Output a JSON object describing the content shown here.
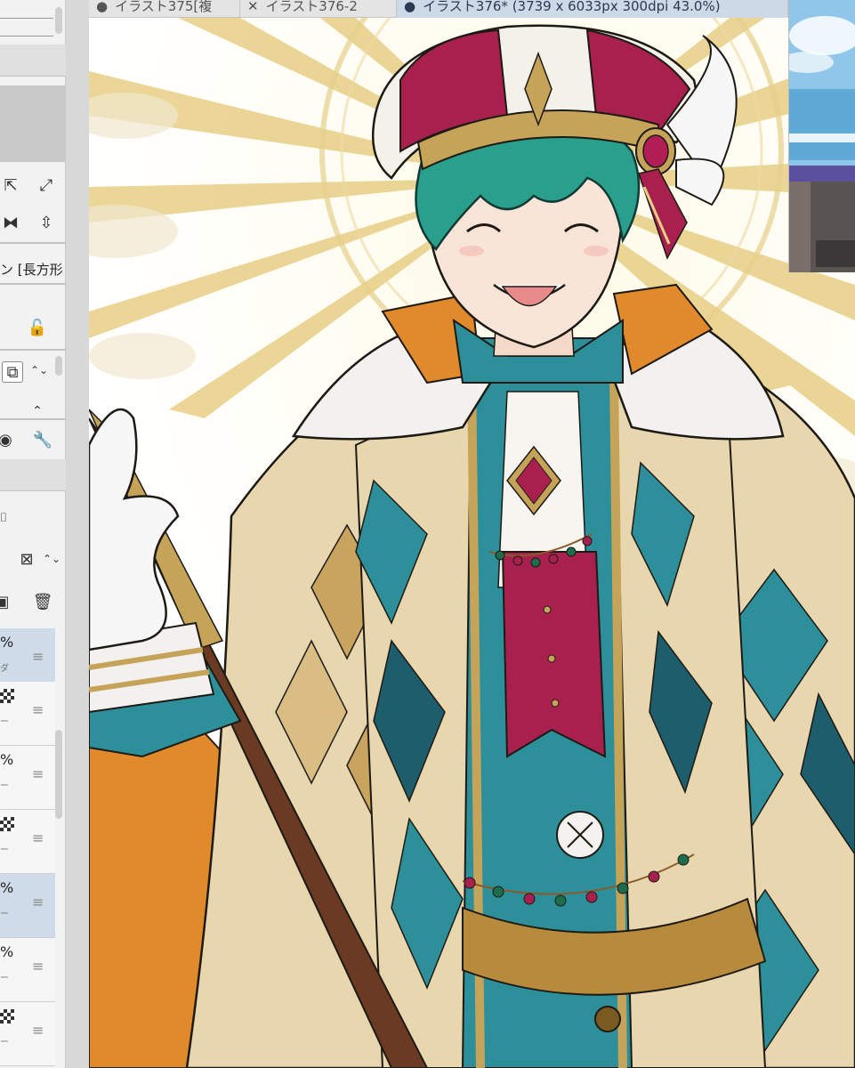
{
  "tabs": [
    {
      "label": "イラスト375[複",
      "marker": "●"
    },
    {
      "label": "イラスト376-2",
      "marker": "✕"
    },
    {
      "label": "イラスト376* (3739 x 6033px 300dpi 43.0%)",
      "marker": "●"
    }
  ],
  "tool_property": {
    "shape_label": "ン [長方形"
  },
  "layers": [
    {
      "opacity": "%",
      "sub": "ダ"
    },
    {
      "opacity": "",
      "sub": "ー"
    },
    {
      "opacity": "%",
      "sub": "ー"
    },
    {
      "opacity": "",
      "sub": "ー"
    },
    {
      "opacity": "%",
      "sub": "ー"
    },
    {
      "opacity": "%",
      "sub": "ー"
    },
    {
      "opacity": "",
      "sub": "ー"
    }
  ],
  "colors": {
    "teal": "#2d8f9a",
    "dark_teal": "#1d5d6c",
    "magenta": "#a8204e",
    "gold": "#c5a45a",
    "beige": "#e8d6ae",
    "orange": "#e08a2c",
    "hair": "#2aa08c"
  }
}
